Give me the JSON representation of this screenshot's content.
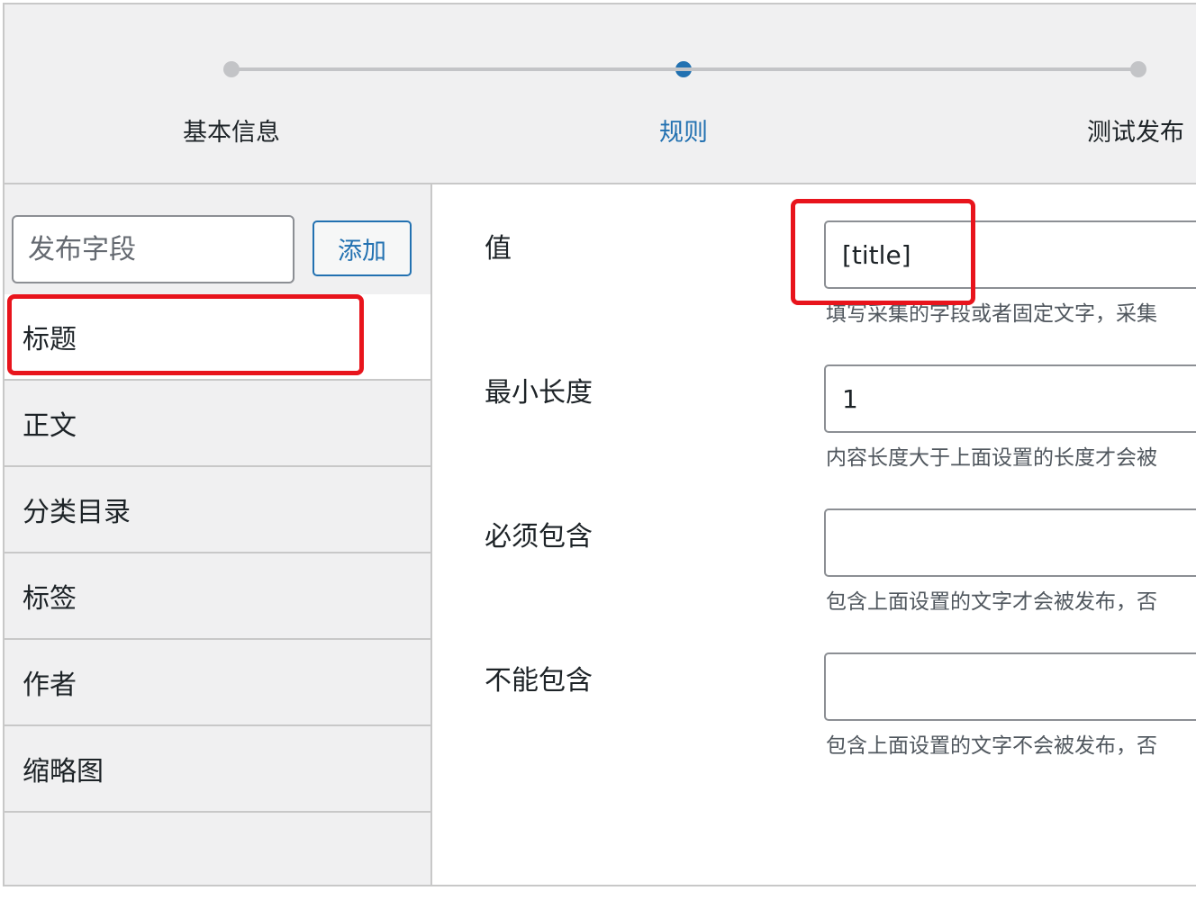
{
  "stepper": {
    "steps": [
      {
        "label": "基本信息",
        "active": false
      },
      {
        "label": "规则",
        "active": true
      },
      {
        "label": "测试发布",
        "active": false
      }
    ]
  },
  "sidebar": {
    "field_input_placeholder": "发布字段",
    "add_button_label": "添加",
    "items": [
      {
        "label": "标题",
        "active": true
      },
      {
        "label": "正文"
      },
      {
        "label": "分类目录"
      },
      {
        "label": "标签"
      },
      {
        "label": "作者"
      },
      {
        "label": "缩略图"
      }
    ]
  },
  "form": {
    "value": {
      "label": "值",
      "input_value": "[title]",
      "description": "填写采集的字段或者固定文字，采集"
    },
    "min_length": {
      "label": "最小长度",
      "input_value": "1",
      "description": "内容长度大于上面设置的长度才会被"
    },
    "must_contain": {
      "label": "必须包含",
      "input_value": "",
      "description": "包含上面设置的文字才会被发布，否"
    },
    "must_not_contain": {
      "label": "不能包含",
      "input_value": "",
      "description": "包含上面设置的文字不会被发布，否"
    }
  },
  "colors": {
    "accent": "#2271b1",
    "highlight": "#e8141c",
    "panel_bg": "#f0f0f1"
  }
}
